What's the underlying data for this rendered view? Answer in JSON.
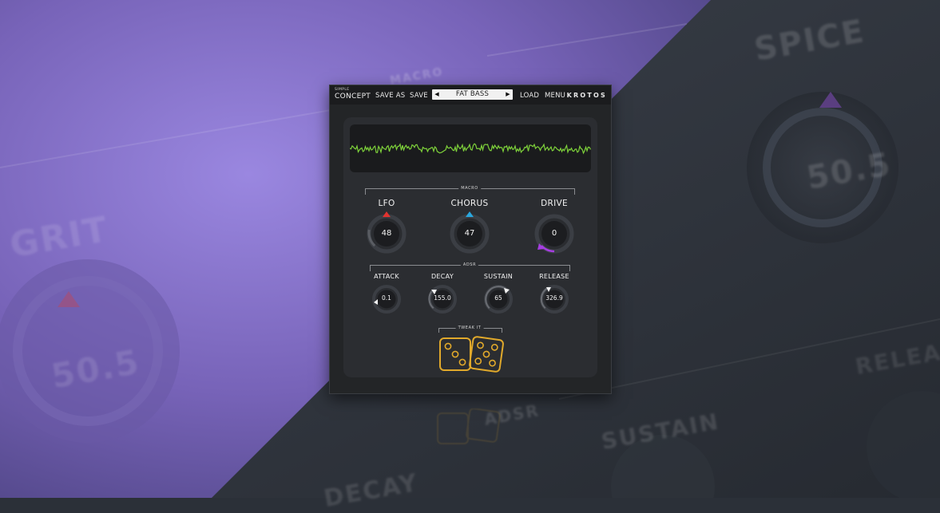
{
  "background": {
    "ghost_labels": {
      "macro": "MACRO",
      "spice": "SPICE",
      "spice_value": "50.5",
      "grit": "GRIT",
      "grit_value": "50.5",
      "release": "RELEASE",
      "adsr": "ADSR",
      "sustain": "SUSTAIN",
      "decay": "DECAY"
    },
    "colors": {
      "purple": "#7d6dbd",
      "slate": "#2f353e"
    }
  },
  "topbar": {
    "logo_small": "SIMPLE",
    "logo_big": "CONCEPT",
    "save_as": "SAVE AS",
    "save": "SAVE",
    "preset_name": "FAT BASS",
    "prev_arrow": "◀",
    "next_arrow": "▶",
    "load": "LOAD",
    "menu": "MENU",
    "brand": "KROTOS"
  },
  "waveform": {
    "color": "#7ed23a",
    "icon": "waveform-display"
  },
  "macro": {
    "section_label": "MACRO",
    "knobs": [
      {
        "label": "LFO",
        "value": "48",
        "accent": "#e0332f"
      },
      {
        "label": "CHORUS",
        "value": "47",
        "accent": "#2aa7de"
      },
      {
        "label": "DRIVE",
        "value": "0",
        "accent": "#a53ee0"
      }
    ]
  },
  "adsr": {
    "section_label": "ADSR",
    "knobs": [
      {
        "label": "ATTACK",
        "value": "0.1"
      },
      {
        "label": "DECAY",
        "value": "155.0"
      },
      {
        "label": "SUSTAIN",
        "value": "65"
      },
      {
        "label": "RELEASE",
        "value": "326.9"
      }
    ]
  },
  "tweak": {
    "section_label": "TWEAK IT",
    "icon": "dice-icon",
    "color": "#e1a92b"
  }
}
